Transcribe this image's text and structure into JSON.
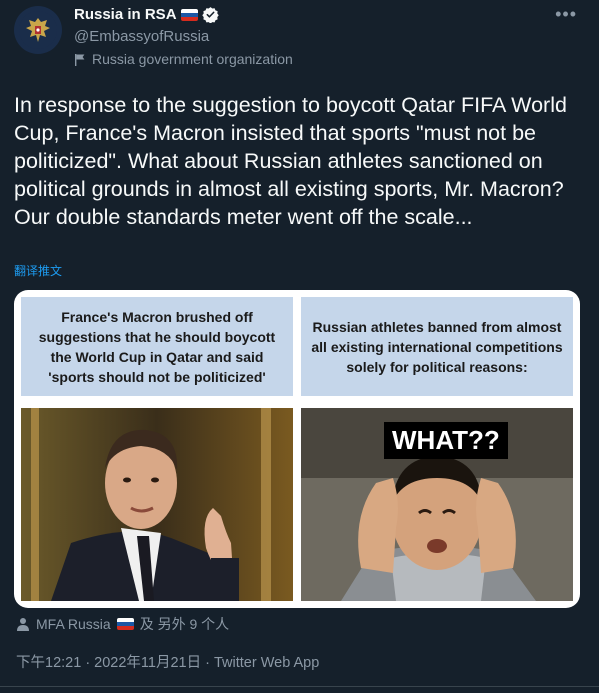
{
  "author": {
    "display_name": "Russia in RSA",
    "handle": "@EmbassyofRussia",
    "label": "Russia government organization",
    "flag_emoji": "russia-flag",
    "verified": true
  },
  "tweet": {
    "text": "In response to the suggestion to boycott Qatar FIFA World Cup, France's Macron insisted that sports \"must not be politicized\". What about Russian athletes sanctioned on political grounds in almost all existing sports, Mr. Macron? Our double standards meter went off the scale...",
    "translate_link": "翻译推文"
  },
  "media": {
    "left_caption": "France's Macron brushed off suggestions that he should boycott the World Cup in Qatar and said 'sports should not be politicized'",
    "right_caption": "Russian athletes banned from almost all existing international competitions solely for political reasons:",
    "meme_text": "WHAT??"
  },
  "tagged": {
    "text_before": "MFA Russia",
    "text_after": "及 另外 9 个人"
  },
  "meta": {
    "timestamp": "下午12:21 · 2022年11月21日 · Twitter Web App"
  },
  "colors": {
    "background": "#15202b",
    "accent": "#1d9bf0",
    "secondary_text": "#8b98a5",
    "caption_bg": "#c5d6ea"
  }
}
